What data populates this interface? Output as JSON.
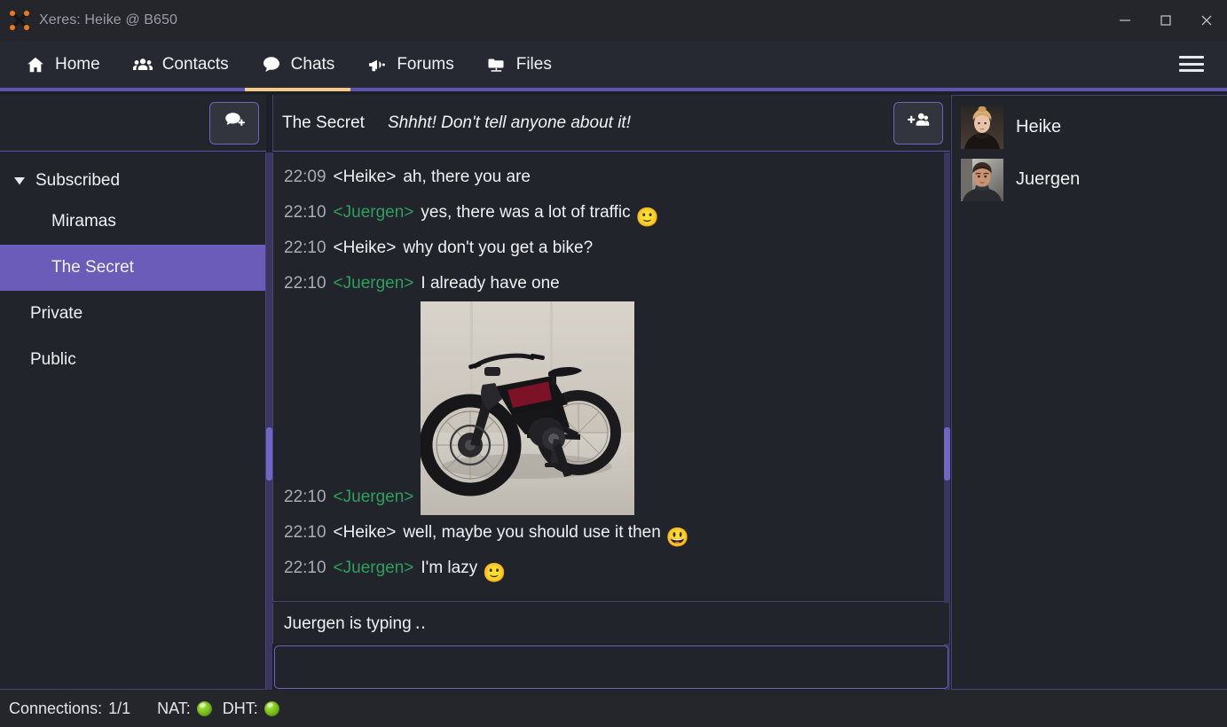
{
  "window": {
    "title": "Xeres: Heike @ B650",
    "app_icon": "xeres-x-icon",
    "controls": {
      "minimize": "minimize-icon",
      "maximize": "maximize-icon",
      "close": "close-icon"
    }
  },
  "nav": {
    "items": [
      {
        "label": "Home",
        "icon": "home-icon",
        "active": false
      },
      {
        "label": "Contacts",
        "icon": "contacts-icon",
        "active": false
      },
      {
        "label": "Chats",
        "icon": "chat-bubble-icon",
        "active": true
      },
      {
        "label": "Forums",
        "icon": "megaphone-icon",
        "active": false
      },
      {
        "label": "Files",
        "icon": "folder-network-icon",
        "active": false
      }
    ],
    "menu_icon": "hamburger-menu-icon",
    "active_indicator_color": "#f4c98a",
    "border_color": "#5f54ad"
  },
  "sidebar": {
    "new_chat_button": {
      "icon": "new-chat-bubble-plus-icon",
      "label": ""
    },
    "tree": {
      "group_label": "Subscribed",
      "group_expanded": true,
      "subscribed": [
        {
          "label": "Miramas",
          "selected": false
        },
        {
          "label": "The Secret",
          "selected": true
        }
      ],
      "roots": [
        {
          "label": "Private"
        },
        {
          "label": "Public"
        }
      ]
    },
    "selected_color": "#6a5cb8"
  },
  "chat": {
    "room_name": "The Secret",
    "topic": "Shhht! Don't tell anyone about it!",
    "invite_button": {
      "icon": "add-person-icon",
      "label": ""
    },
    "messages": [
      {
        "time": "22:09",
        "author": "<Heike>",
        "author_kind": "heike",
        "text": "ah, there you are",
        "emoji": "",
        "image": false
      },
      {
        "time": "22:10",
        "author": "<Juergen>",
        "author_kind": "juergen",
        "text": "yes, there was a lot of traffic",
        "emoji": "🙂",
        "image": false
      },
      {
        "time": "22:10",
        "author": "<Heike>",
        "author_kind": "heike",
        "text": "why don't you get a bike?",
        "emoji": "",
        "image": false
      },
      {
        "time": "22:10",
        "author": "<Juergen>",
        "author_kind": "juergen",
        "text": "I already have one",
        "emoji": "",
        "image": false
      },
      {
        "time": "22:10",
        "author": "<Juergen>",
        "author_kind": "juergen",
        "text": "",
        "emoji": "",
        "image": true,
        "image_alt": "black electric mountain bike photo"
      },
      {
        "time": "22:10",
        "author": "<Heike>",
        "author_kind": "heike",
        "text": "well, maybe you should use it then",
        "emoji": "😃",
        "image": false
      },
      {
        "time": "22:10",
        "author": "<Juergen>",
        "author_kind": "juergen",
        "text": "I'm lazy",
        "emoji": "🙂",
        "image": false
      }
    ],
    "typing_status": "Juergen is typing ‥",
    "composer": {
      "value": "",
      "placeholder": ""
    },
    "author_color_juergen": "#2f9e5f",
    "author_color_heike": "#f0f1f4"
  },
  "members": {
    "list": [
      {
        "name": "Heike",
        "avatar": "avatar-heike"
      },
      {
        "name": "Juergen",
        "avatar": "avatar-juergen"
      }
    ]
  },
  "statusbar": {
    "connections_label": "Connections:",
    "connections_value": "1/1",
    "nat_label": "NAT:",
    "nat_state": "ok",
    "dht_label": "DHT:",
    "dht_state": "ok",
    "led_color": "#7fc520"
  }
}
